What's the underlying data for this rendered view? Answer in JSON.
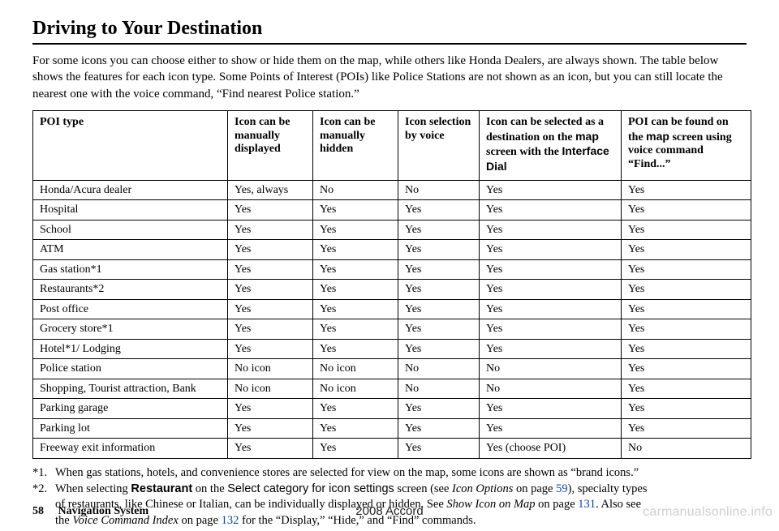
{
  "title": "Driving to Your Destination",
  "intro": "For some icons you can choose either to show or hide them on the map, while others like Honda Dealers, are always shown. The table below shows the features for each icon type. Some Points of Interest (POIs) like Police Stations are not shown as an icon, but you can still locate the nearest one with the voice command, “Find nearest Police station.”",
  "table": {
    "headers": {
      "poi_type": "POI type",
      "man_disp": "Icon can be manually displayed",
      "man_hide": "Icon can be manually hidden",
      "sel_voice": "Icon selection by voice",
      "sel_dest_pre": "Icon can be selected as a destination on the ",
      "sel_dest_sans1": "map",
      "sel_dest_mid": " screen with the ",
      "sel_dest_sans2": "Interface Dial",
      "find_pre": "POI can be found on the ",
      "find_sans": "map",
      "find_post": " screen using voice command “Find...”"
    },
    "rows": [
      {
        "poi": "Honda/Acura dealer",
        "c2": "Yes, always",
        "c3": "No",
        "c4": "No",
        "c5": "Yes",
        "c6": "Yes"
      },
      {
        "poi": "Hospital",
        "c2": "Yes",
        "c3": "Yes",
        "c4": "Yes",
        "c5": "Yes",
        "c6": "Yes"
      },
      {
        "poi": "School",
        "c2": "Yes",
        "c3": "Yes",
        "c4": "Yes",
        "c5": "Yes",
        "c6": "Yes"
      },
      {
        "poi": "ATM",
        "c2": "Yes",
        "c3": "Yes",
        "c4": "Yes",
        "c5": "Yes",
        "c6": "Yes"
      },
      {
        "poi": "Gas station*1",
        "c2": "Yes",
        "c3": "Yes",
        "c4": "Yes",
        "c5": "Yes",
        "c6": "Yes"
      },
      {
        "poi": "Restaurants*2",
        "c2": "Yes",
        "c3": "Yes",
        "c4": "Yes",
        "c5": "Yes",
        "c6": "Yes"
      },
      {
        "poi": "Post office",
        "c2": "Yes",
        "c3": "Yes",
        "c4": "Yes",
        "c5": "Yes",
        "c6": "Yes"
      },
      {
        "poi": "Grocery store*1",
        "c2": "Yes",
        "c3": "Yes",
        "c4": "Yes",
        "c5": "Yes",
        "c6": "Yes"
      },
      {
        "poi": "Hotel*1/ Lodging",
        "c2": "Yes",
        "c3": "Yes",
        "c4": "Yes",
        "c5": "Yes",
        "c6": "Yes"
      },
      {
        "poi": "Police station",
        "c2": "No icon",
        "c3": "No icon",
        "c4": "No",
        "c5": "No",
        "c6": "Yes"
      },
      {
        "poi": "Shopping, Tourist attraction, Bank",
        "c2": "No icon",
        "c3": "No icon",
        "c4": "No",
        "c5": "No",
        "c6": "Yes"
      },
      {
        "poi": "Parking garage",
        "c2": "Yes",
        "c3": "Yes",
        "c4": "Yes",
        "c5": "Yes",
        "c6": "Yes"
      },
      {
        "poi": "Parking lot",
        "c2": "Yes",
        "c3": "Yes",
        "c4": "Yes",
        "c5": "Yes",
        "c6": "Yes"
      },
      {
        "poi": "Freeway exit information",
        "c2": "Yes",
        "c3": "Yes",
        "c4": "Yes",
        "c5": "Yes (choose POI)",
        "c6": "No"
      }
    ]
  },
  "notes": {
    "n1_label": "*1.",
    "n1_text": "When gas stations, hotels, and convenience stores are selected for view on the map, some icons are shown as “brand icons.”",
    "n2_label": "*2.",
    "n2a_pre": "When selecting ",
    "n2a_bold": "Restaurant",
    "n2a_mid1": " on the ",
    "n2a_sans": "Select category for icon settings",
    "n2a_mid2": " screen (see ",
    "n2a_ital": "Icon Options",
    "n2a_mid3": " on page ",
    "n2a_link": "59",
    "n2a_end": "), specialty types",
    "n2b_pre": "of restaurants, like Chinese or Italian, can be individually displayed or hidden. See ",
    "n2b_ital": "Show Icon on Map",
    "n2b_mid": " on page ",
    "n2b_link": "131",
    "n2b_end": ". Also see",
    "n2c_pre": "the ",
    "n2c_ital": "Voice Command Index",
    "n2c_mid": " on page ",
    "n2c_link": "132",
    "n2c_end": " for the “Display,” “Hide,” and “Find” commands."
  },
  "footer": {
    "page_num": "58",
    "section": "Navigation System",
    "center": "2008  Accord",
    "watermark": "carmanualsonline.info"
  }
}
